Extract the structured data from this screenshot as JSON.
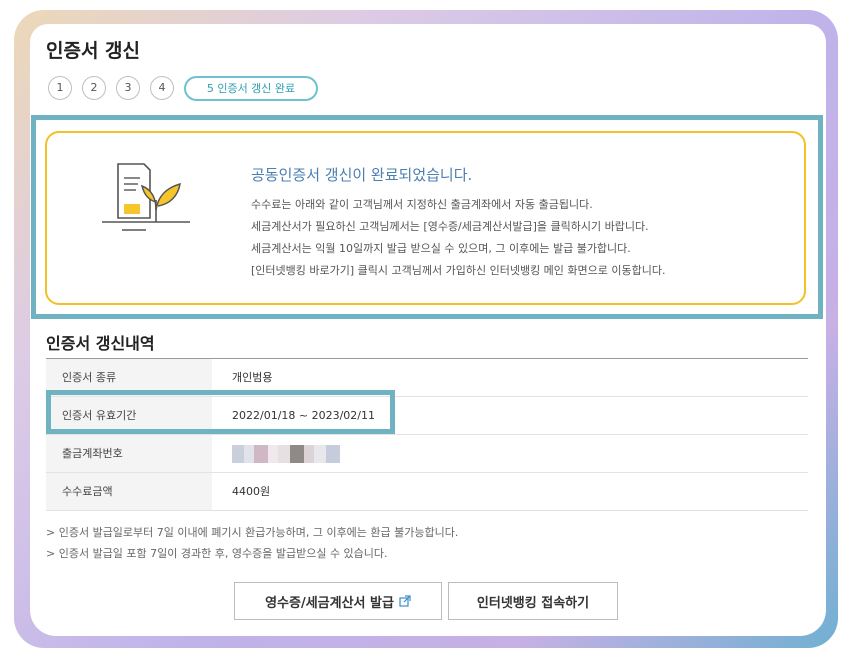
{
  "page": {
    "title": "인증서 갱신"
  },
  "steps": {
    "items": [
      "1",
      "2",
      "3",
      "4"
    ],
    "current": "5 인증서 갱신 완료"
  },
  "notice": {
    "title": "공동인증서 갱신이 완료되었습니다.",
    "lines": [
      "수수료는 아래와 같이 고객님께서 지정하신 출금계좌에서 자동 출금됩니다.",
      "세금계산서가 필요하신 고객님께서는 [영수증/세금계산서발급]을 클릭하시기 바랍니다.",
      "세금계산서는 익월 10일까지 발급 받으실 수 있으며, 그 이후에는 발급 불가합니다.",
      "[인터넷뱅킹 바로가기] 클릭시 고객님께서 가입하신 인터넷뱅킹 메인 화면으로 이동합니다."
    ]
  },
  "details": {
    "title": "인증서 갱신내역",
    "rows": [
      {
        "label": "인증서 종류",
        "value": "개인범용"
      },
      {
        "label": "인증서 유효기간",
        "value": "2022/01/18 ~ 2023/02/11"
      },
      {
        "label": "출금계좌번호",
        "value": ""
      },
      {
        "label": "수수료금액",
        "value": "4400원"
      }
    ]
  },
  "notes": [
    "> 인증서 발급일로부터 7일 이내에 폐기시 환급가능하며, 그 이후에는 환급 불가능합니다.",
    "> 인증서 발급일 포함 7일이 경과한 후, 영수증을 발급받으실 수 있습니다."
  ],
  "buttons": {
    "receipt": "영수증/세금계산서 발급",
    "banking": "인터넷뱅킹 접속하기"
  },
  "colors": {
    "accent_teal": "#6fb3c3",
    "accent_yellow": "#f3c126",
    "title_blue": "#4b7fb2"
  },
  "icons": {
    "illustration": "document-leaf-icon",
    "external": "external-link-icon"
  }
}
